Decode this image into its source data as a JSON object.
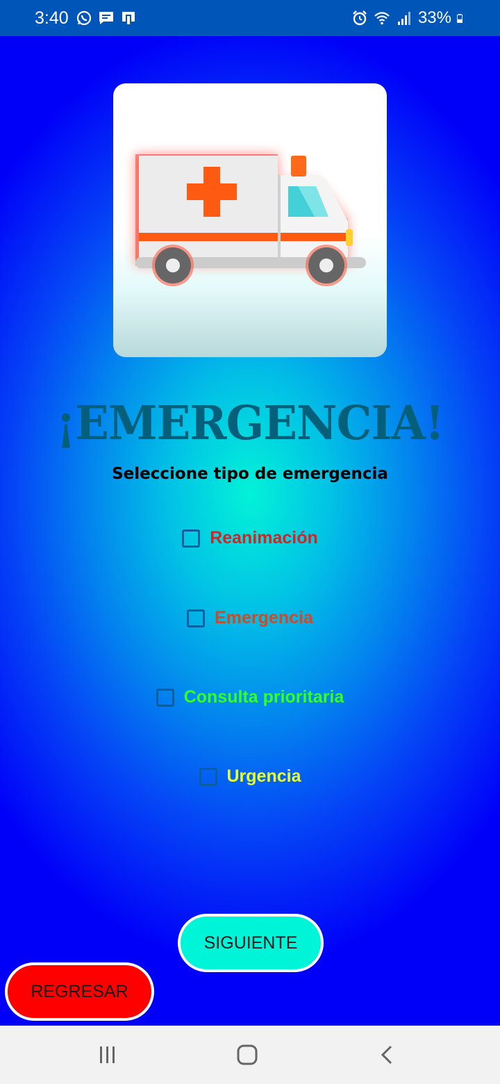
{
  "status_bar": {
    "time": "3:40",
    "battery": "33%",
    "icons_left": [
      "whatsapp-icon",
      "message-icon",
      "cast-icon"
    ],
    "icons_right": [
      "alarm-icon",
      "wifi-icon",
      "signal-icon",
      "battery-icon"
    ]
  },
  "header": {
    "image": "ambulance-image"
  },
  "title": "¡EMERGENCIA!",
  "subtitle": "Seleccione tipo de emergencia",
  "options": [
    {
      "label": "Reanimación",
      "color": "#d42424",
      "checked": false
    },
    {
      "label": "Emergencia",
      "color": "#d14a24",
      "checked": false
    },
    {
      "label": "Consulta prioritaria",
      "color": "#33ff22",
      "checked": false
    },
    {
      "label": "Urgencia",
      "color": "#e6ff2e",
      "checked": false
    }
  ],
  "buttons": {
    "next_label": "SIGUIENTE",
    "back_label": "REGRESAR",
    "next_color": "#00f5d8",
    "back_color": "#ff0000"
  },
  "nav_bar": {
    "items": [
      "recent-apps-icon",
      "home-icon",
      "back-icon"
    ]
  }
}
